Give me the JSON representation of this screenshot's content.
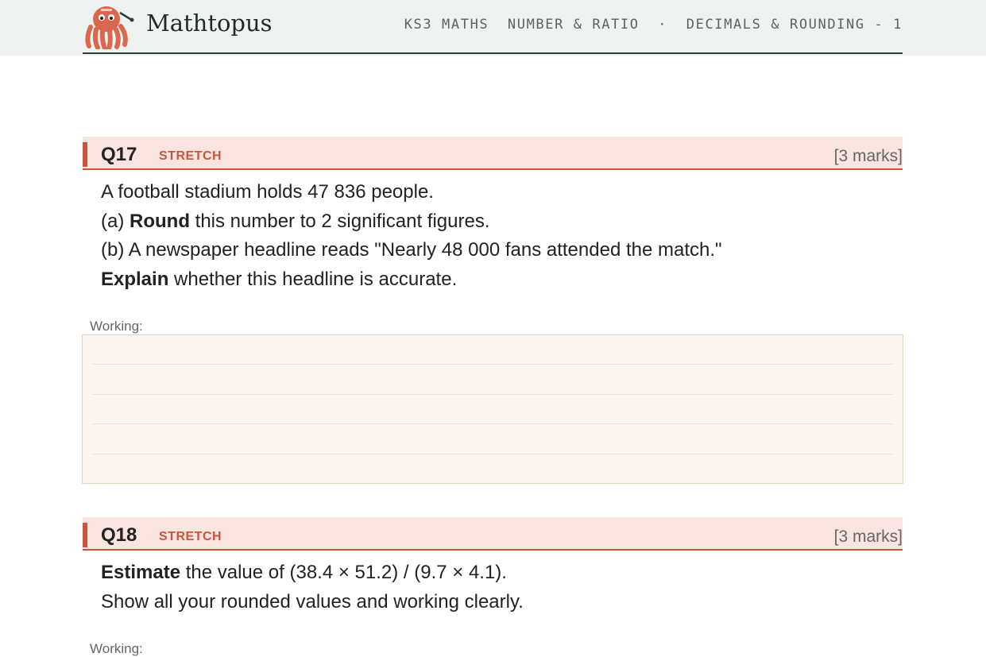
{
  "brand": {
    "name": "Mathtopus",
    "logo_icon": "octopus-icon"
  },
  "breadcrumb": {
    "course": "KS3 MATHS",
    "unit": "NUMBER & RATIO",
    "separator": "·",
    "topic": "DECIMALS & ROUNDING - 1"
  },
  "questions": [
    {
      "number": "Q17",
      "tag": "STRETCH",
      "marks": "[3 marks]",
      "lines": [
        {
          "text": "A football stadium holds 47 836 people."
        },
        {
          "prefix": "(a) ",
          "bold": "Round",
          "text": " this number to 2 significant figures."
        },
        {
          "text": "(b) A newspaper headline reads \"Nearly 48 000 fans attended the match.\""
        },
        {
          "bold": "Explain",
          "text": " whether this headline is accurate."
        }
      ],
      "working_label": "Working:"
    },
    {
      "number": "Q18",
      "tag": "STRETCH",
      "marks": "[3 marks]",
      "lines": [
        {
          "bold": "Estimate",
          "text": " the value of (38.4 × 51.2) / (9.7 × 4.1)."
        },
        {
          "text": "Show all your rounded values and working clearly."
        }
      ],
      "working_label": "Working:"
    }
  ],
  "colors": {
    "accent": "#c8553d",
    "header_bg": "#f9e4df",
    "topbar_bg": "#eef3f2",
    "working_bg": "#fbf6ef"
  }
}
